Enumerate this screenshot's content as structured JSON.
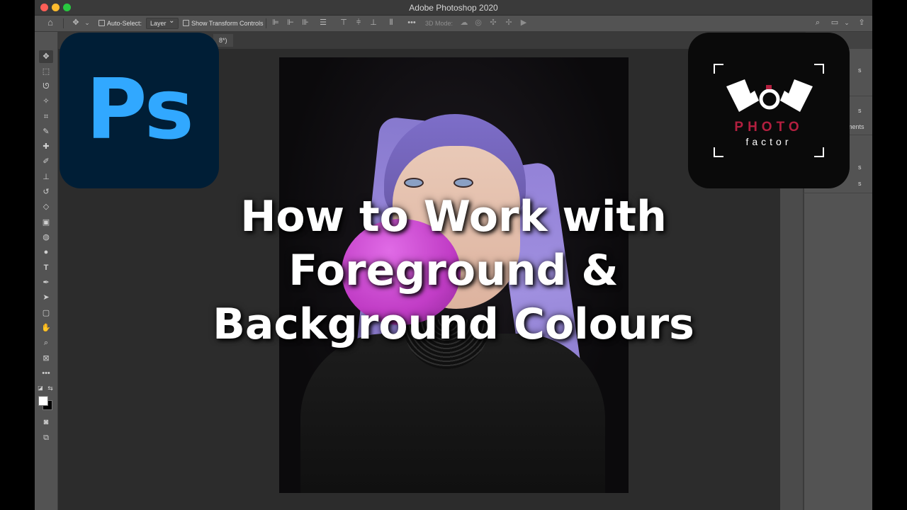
{
  "window": {
    "title": "Adobe Photoshop 2020"
  },
  "options_bar": {
    "auto_select_label": "Auto-Select:",
    "auto_select_value": "Layer",
    "transform_label": "Show Transform Controls",
    "mode_3d_label": "3D Mode:"
  },
  "document_tab": {
    "title": "8*)"
  },
  "tools": [
    "move-tool",
    "marquee-tool",
    "lasso-tool",
    "magic-wand-tool",
    "crop-tool",
    "eyedropper-tool",
    "healing-brush-tool",
    "brush-tool",
    "clone-stamp-tool",
    "history-brush-tool",
    "eraser-tool",
    "gradient-tool",
    "blur-tool",
    "dodge-tool",
    "type-tool",
    "pen-tool",
    "path-selection-tool",
    "shape-tool",
    "hand-tool",
    "zoom-tool",
    "frame-tool",
    "more-tools"
  ],
  "colors": {
    "foreground": "#ffffff",
    "background": "#000000"
  },
  "right_panel": {
    "label_1": "s",
    "label_2": "s",
    "label_3": "ments",
    "label_4": "s",
    "label_5": "s"
  },
  "logos": {
    "photoshop_letters": "Ps",
    "photofactor_line1": "PHOTO",
    "photofactor_line2": "factor"
  },
  "headline": {
    "line1": "How to Work with",
    "line2": "Foreground &",
    "line3": "Background Colours"
  }
}
